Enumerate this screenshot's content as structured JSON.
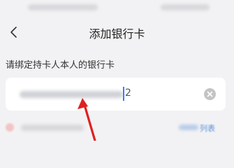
{
  "header": {
    "title": "添加银行卡"
  },
  "form": {
    "hint": "请绑定持卡人本人的银行卡",
    "card_number_visible": "2"
  },
  "footer": {
    "support_link": "列表"
  },
  "icons": {
    "back": "chevron-left-icon",
    "clear": "close-circle-icon"
  },
  "colors": {
    "background": "#f2f2f4",
    "caret": "#3a7bff",
    "annotation_arrow": "#e02020",
    "link": "#5b8fd6"
  }
}
